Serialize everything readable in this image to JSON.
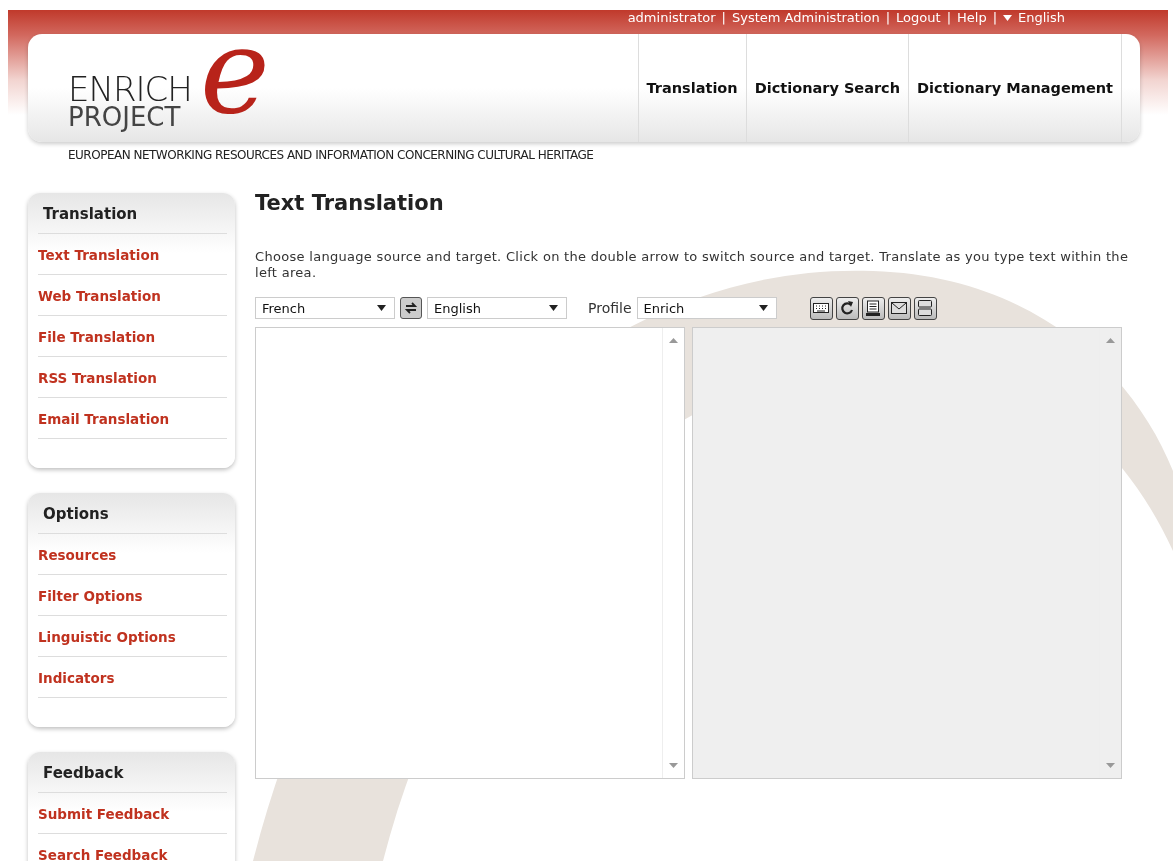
{
  "top_links": [
    {
      "label": "administrator"
    },
    {
      "label": "System Administration"
    },
    {
      "label": "Logout"
    },
    {
      "label": "Help"
    },
    {
      "label": "English",
      "kind": "dropdown"
    }
  ],
  "separator": "|",
  "logo": {
    "mark": "e",
    "line1": "ENRICH",
    "line2": "PROJECT"
  },
  "main_nav": [
    {
      "label": "Translation"
    },
    {
      "label": "Dictionary Search"
    },
    {
      "label": "Dictionary Management"
    }
  ],
  "tagline": "EUROPEAN NETWORKING RESOURCES AND INFORMATION CONCERNING CULTURAL HERITAGE",
  "sidebar": [
    {
      "title": "Translation",
      "items": [
        "Text Translation",
        "Web Translation",
        "File Translation",
        "RSS Translation",
        "Email Translation"
      ]
    },
    {
      "title": "Options",
      "items": [
        "Resources",
        "Filter Options",
        "Linguistic Options",
        "Indicators"
      ]
    },
    {
      "title": "Feedback",
      "items": [
        "Submit Feedback",
        "Search Feedback"
      ]
    }
  ],
  "page_title": "Text Translation",
  "instructions": "Choose language source and target. Click on the double arrow to switch source and target. Translate as you type text within the left area.",
  "source_language": "French",
  "target_language": "English",
  "profile_label": "Profile",
  "profile": "Enrich",
  "tools": [
    {
      "kind": "keyboard"
    },
    {
      "kind": "refresh"
    },
    {
      "kind": "document"
    },
    {
      "kind": "mail"
    },
    {
      "kind": "split"
    }
  ]
}
